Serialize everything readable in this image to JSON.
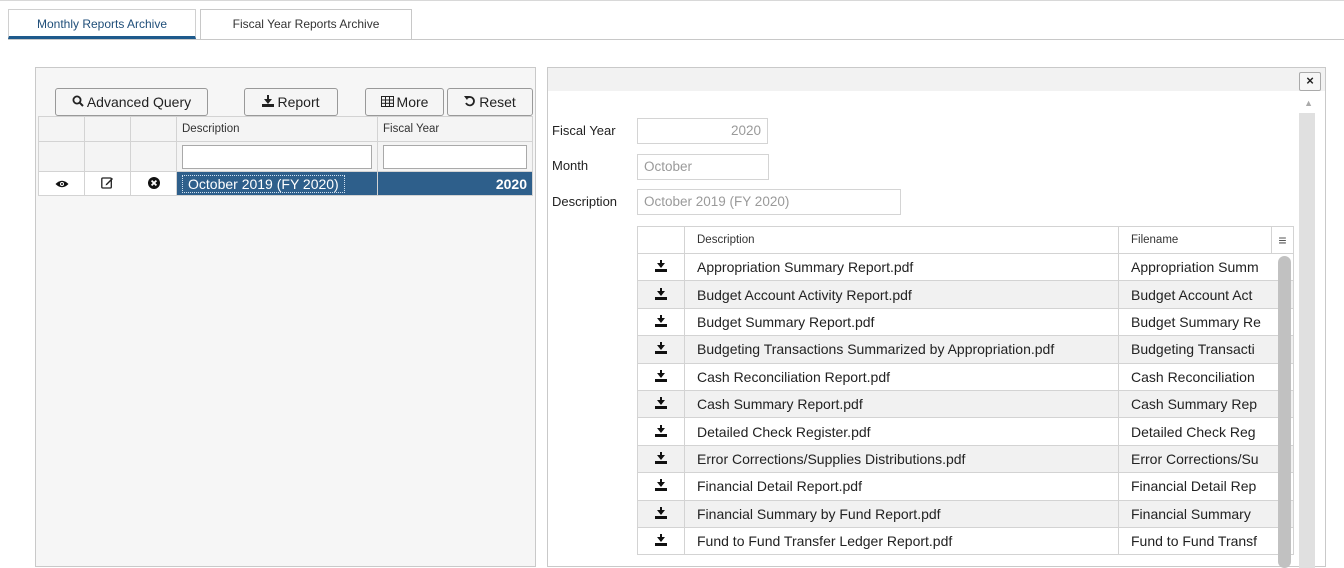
{
  "tabs": [
    {
      "label": "Monthly Reports Archive",
      "active": true
    },
    {
      "label": "Fiscal Year Reports Archive",
      "active": false
    }
  ],
  "toolbar": {
    "advanced_query": "Advanced Query",
    "report": "Report",
    "more": "More",
    "reset": "Reset",
    "icons": {
      "advanced_query": "search-icon",
      "report": "download-icon",
      "more": "grid-icon",
      "reset": "undo-icon"
    }
  },
  "left_grid": {
    "headers": [
      "Description",
      "Fiscal Year"
    ],
    "filter_placeholders": [
      "",
      ""
    ],
    "rows": [
      {
        "description": "October 2019 (FY 2020)",
        "fiscal_year": "2020",
        "icons": [
          "eye-icon",
          "edit-icon",
          "delete-icon"
        ]
      }
    ]
  },
  "detail": {
    "close": "×",
    "fields": {
      "fiscal_year": {
        "label": "Fiscal Year",
        "value": "2020"
      },
      "month": {
        "label": "Month",
        "value": "October"
      },
      "description": {
        "label": "Description",
        "value": "October 2019 (FY 2020)"
      }
    },
    "files": {
      "headers": [
        "Description",
        "Filename"
      ],
      "menu_icon": "≡",
      "rows": [
        {
          "description": "Appropriation Summary Report.pdf",
          "filename": "Appropriation Summ"
        },
        {
          "description": "Budget Account Activity Report.pdf",
          "filename": "Budget Account Act"
        },
        {
          "description": "Budget Summary Report.pdf",
          "filename": "Budget Summary Re"
        },
        {
          "description": "Budgeting Transactions Summarized by Appropriation.pdf",
          "filename": "Budgeting Transacti"
        },
        {
          "description": "Cash Reconciliation Report.pdf",
          "filename": "Cash Reconciliation"
        },
        {
          "description": "Cash Summary Report.pdf",
          "filename": "Cash Summary Rep"
        },
        {
          "description": "Detailed Check Register.pdf",
          "filename": "Detailed Check Reg"
        },
        {
          "description": "Error Corrections/Supplies Distributions.pdf",
          "filename": "Error Corrections/Su"
        },
        {
          "description": "Financial Detail Report.pdf",
          "filename": "Financial Detail Rep"
        },
        {
          "description": "Financial Summary by Fund Report.pdf",
          "filename": "Financial Summary"
        },
        {
          "description": "Fund to Fund Transfer Ledger Report.pdf",
          "filename": "Fund to Fund Transf"
        }
      ]
    }
  },
  "colors": {
    "accent": "#2e5f8b",
    "tab_underline": "#1e5a8c"
  }
}
